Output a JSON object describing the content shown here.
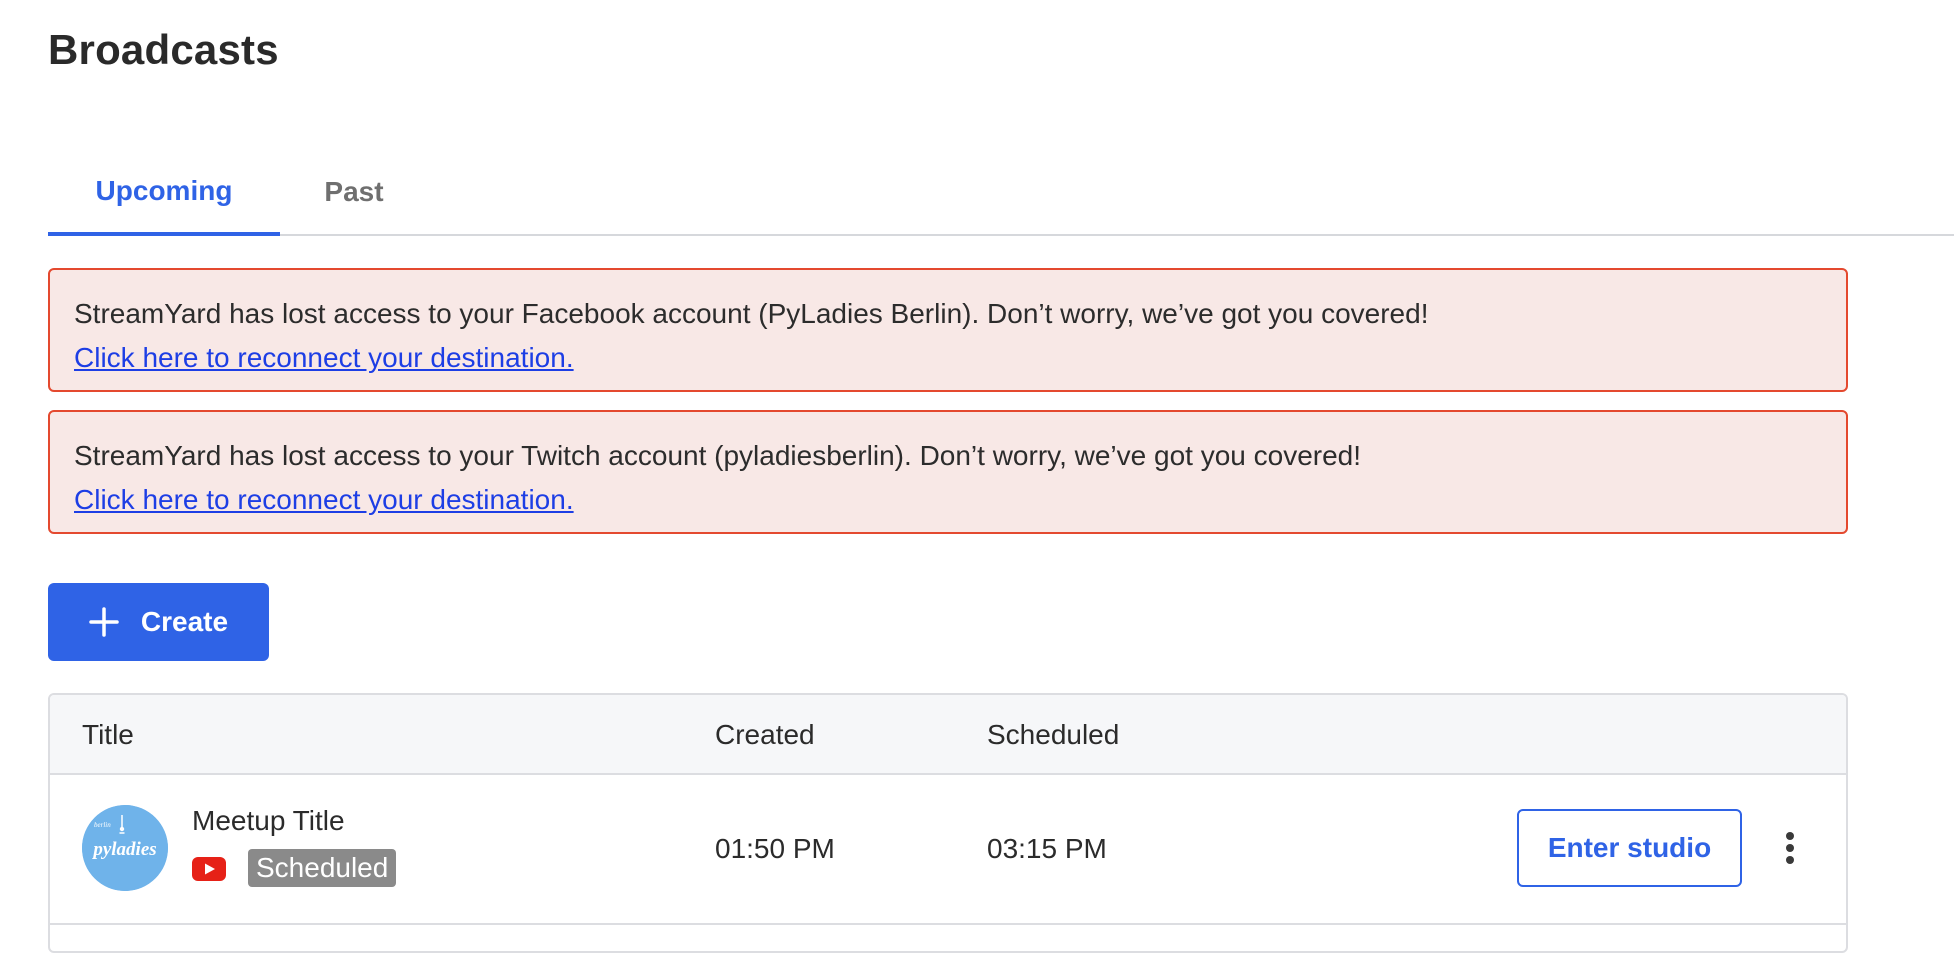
{
  "page": {
    "title": "Broadcasts"
  },
  "tabs": [
    {
      "label": "Upcoming",
      "active": true
    },
    {
      "label": "Past",
      "active": false
    }
  ],
  "alerts": [
    {
      "message": "StreamYard has lost access to your Facebook account (PyLadies Berlin). Don’t worry, we’ve got you covered!",
      "link_text": "Click here to reconnect your destination."
    },
    {
      "message": "StreamYard has lost access to your Twitch account (pyladiesberlin). Don’t worry, we’ve got you covered!",
      "link_text": "Click here to reconnect your destination."
    }
  ],
  "create_button": {
    "label": "Create",
    "icon": "plus-icon"
  },
  "table": {
    "columns": [
      "Title",
      "Created",
      "Scheduled"
    ],
    "rows": [
      {
        "avatar_icon": "pyladies-logo",
        "avatar_text": "pyladies",
        "title": "Meetup Title",
        "destination_icon": "youtube-icon",
        "status": "Scheduled",
        "created": "01:50 PM",
        "scheduled": "03:15 PM",
        "action_label": "Enter studio",
        "more_icon": "vertical-ellipsis-icon"
      }
    ]
  },
  "colors": {
    "primary": "#2f63e6",
    "alert_background": "#f8e8e6",
    "alert_border": "#e4492f",
    "link": "#1d3ee5",
    "badge": "#8a8a8a",
    "youtube": "#e62117"
  }
}
